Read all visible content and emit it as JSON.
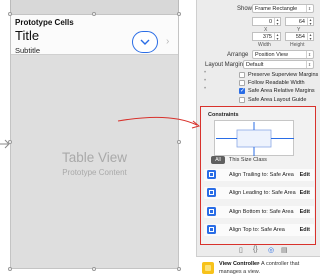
{
  "storyboard": {
    "cell_header": "Prototype Cells",
    "cell_title": "Title",
    "cell_subtitle": "Subtitle",
    "tableview_title": "Table View",
    "tableview_subtitle": "Prototype Content"
  },
  "inspector": {
    "show_label": "Show",
    "show_value": "Frame Rectangle",
    "x_value": "0",
    "y_value": "64",
    "x_label": "X",
    "y_label": "Y",
    "width_value": "375",
    "height_value": "554",
    "width_label": "Width",
    "height_label": "Height",
    "arrange_label": "Arrange",
    "arrange_value": "Position View",
    "layout_margins_label": "Layout Margins",
    "layout_margins_value": "Default",
    "checkboxes": [
      {
        "label": "Preserve Superview Margins",
        "checked": false
      },
      {
        "label": "Follow Readable Width",
        "checked": false
      },
      {
        "label": "Safe Area Relative Margins",
        "checked": true
      },
      {
        "label": "Safe Area Layout Guide",
        "checked": false
      }
    ],
    "constraints_title": "Constraints",
    "size_class_button": "All",
    "size_class_label": "This Size Class",
    "constraint_rows": [
      {
        "text": "Align Trailing to:  Safe Area",
        "action": "Edit"
      },
      {
        "text": "Align Leading to:  Safe Area",
        "action": "Edit"
      },
      {
        "text": "Align Bottom to:  Safe Area",
        "action": "Edit"
      },
      {
        "text": "Align Top to:  Safe Area",
        "action": "Edit"
      }
    ]
  },
  "library": {
    "title": "View Controller",
    "description": "- A controller that",
    "description_2": "manages a view."
  },
  "colors": {
    "accent_blue": "#2a6de6",
    "highlight_red": "#d8322c",
    "library_icon_yellow": "#f7c21a"
  }
}
